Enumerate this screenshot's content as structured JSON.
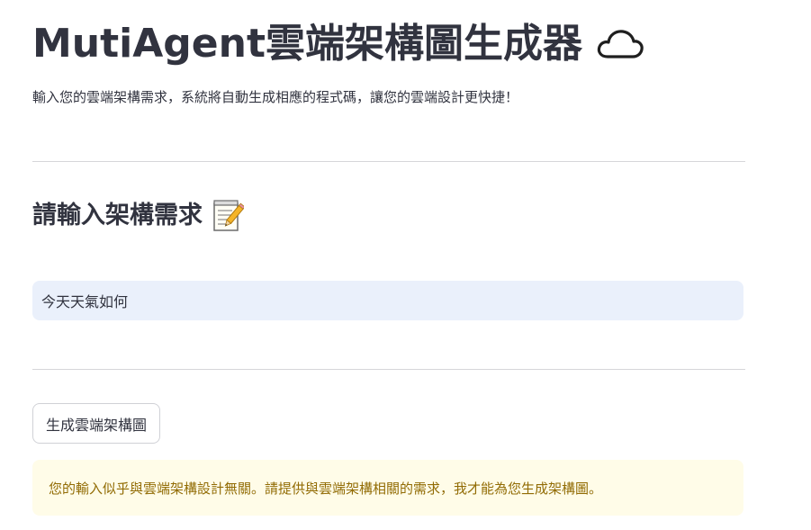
{
  "header": {
    "title": "MutiAgent雲端架構圖生成器",
    "title_icon": "cloud-icon",
    "subtitle": "輸入您的雲端架構需求，系統將自動生成相應的程式碼，讓您的雲端設計更快捷！"
  },
  "form": {
    "section_title": "請輸入架構需求",
    "section_icon": "memo-icon",
    "input_value": "今天天氣如何",
    "generate_button_label": "生成雲端架構圖"
  },
  "alert": {
    "type": "warning",
    "message": "您的輸入似乎與雲端架構設計無關。請提供與雲端架構相關的需求，我才能為您生成架構圖。"
  },
  "colors": {
    "text": "#31333f",
    "input_background": "#eaf0fb",
    "warning_background": "#fffce8",
    "warning_text": "#926c05",
    "divider": "#d6d6d9"
  }
}
